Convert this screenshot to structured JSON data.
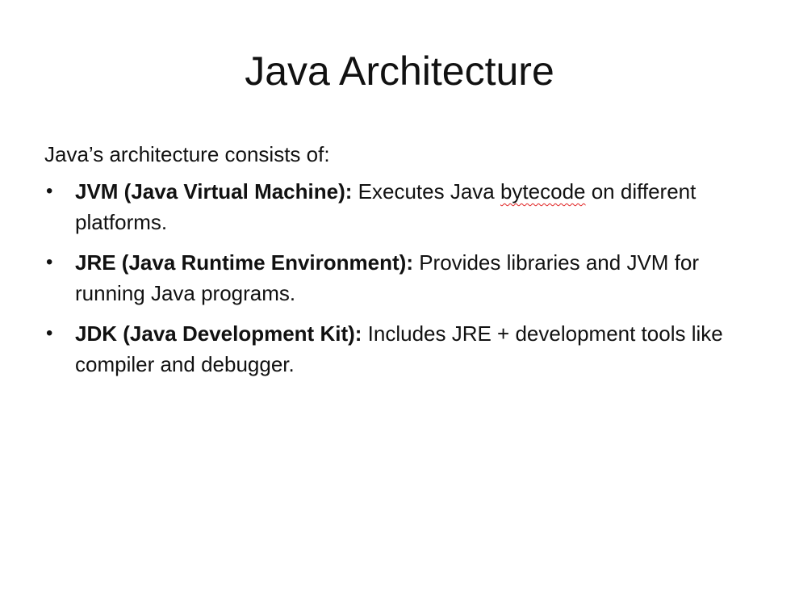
{
  "slide": {
    "title": "Java Architecture",
    "intro": "Java’s architecture consists of:",
    "bullets": [
      {
        "term": "JVM (Java Virtual Machine):",
        "text_before": " Executes Java ",
        "flagged_word": "bytecode",
        "text_after": " on different platforms."
      },
      {
        "term": "JRE (Java Runtime Environment):",
        "text": " Provides libraries and JVM for running Java programs."
      },
      {
        "term": "JDK (Java Development Kit):",
        "text": " Includes JRE + development tools like compiler and debugger."
      }
    ],
    "bullet_glyph": "•",
    "spellcheck_color": "#e02020"
  }
}
